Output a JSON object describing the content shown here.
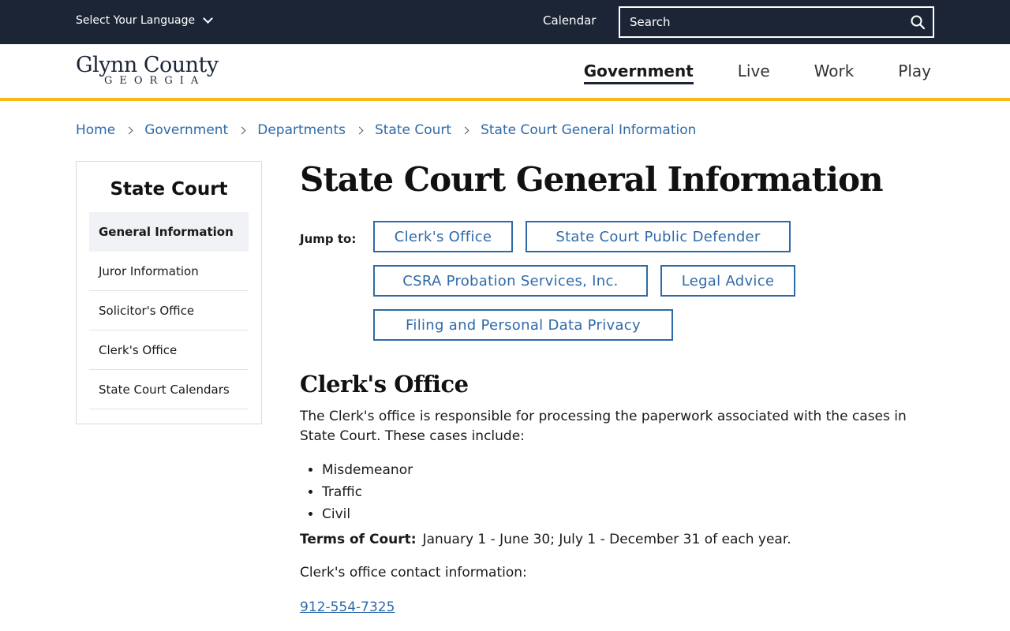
{
  "utility_bar": {
    "language_label": "Select Your Language",
    "calendar_label": "Calendar",
    "search_placeholder": "Search"
  },
  "header": {
    "logo_line1": "Glynn County",
    "logo_line2": "GEORGIA",
    "nav": [
      {
        "label": "Government",
        "active": true
      },
      {
        "label": "Live"
      },
      {
        "label": "Work"
      },
      {
        "label": "Play"
      }
    ]
  },
  "breadcrumb": [
    "Home",
    "Government",
    "Departments",
    "State Court",
    "State Court General Information"
  ],
  "sidebar": {
    "title": "State Court",
    "items": [
      {
        "label": "General Information",
        "active": true
      },
      {
        "label": "Juror Information"
      },
      {
        "label": "Solicitor's Office"
      },
      {
        "label": "Clerk's Office"
      },
      {
        "label": "State Court Calendars"
      }
    ]
  },
  "main": {
    "title": "State Court General Information",
    "jump_label": "Jump to:",
    "jump_links": [
      "Clerk's Office",
      "State Court Public Defender",
      "CSRA Probation Services, Inc.",
      "Legal Advice",
      "Filing and Personal Data Privacy"
    ],
    "section_title": "Clerk's Office",
    "section_text": "The Clerk's office is responsible for processing the paperwork associated with the cases in State Court.  These cases include:",
    "cases": [
      "Misdemeanor",
      "Traffic",
      "Civil"
    ],
    "terms_label": "Terms of Court:",
    "terms_value": "January 1 - June 30; July 1 - December 31 of each year.",
    "contact_label": "Clerk's office contact information:",
    "phone": "912-554-7325"
  },
  "colors": {
    "topbar": "#1c2536",
    "accent_yellow": "#f5b918",
    "link_blue": "#2f6aa8"
  }
}
